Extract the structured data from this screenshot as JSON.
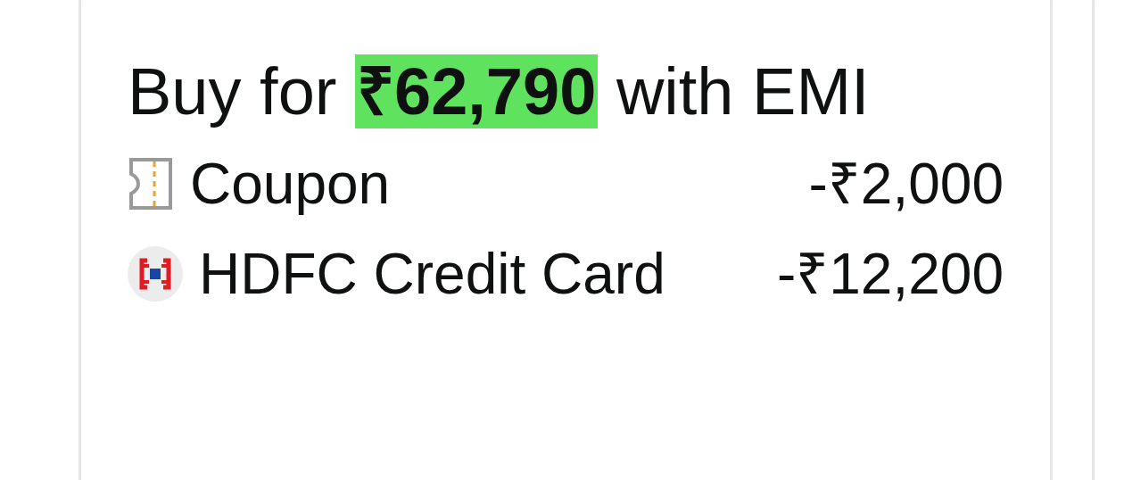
{
  "emi_card": {
    "heading": {
      "prefix": "Buy for",
      "amount": "₹62,790",
      "suffix": "with EMI"
    },
    "offers": [
      {
        "kind": "coupon",
        "label": "Coupon",
        "amount": "-₹2,000"
      },
      {
        "kind": "bank",
        "label": "HDFC Credit Card",
        "amount": "-₹12,200"
      }
    ]
  }
}
